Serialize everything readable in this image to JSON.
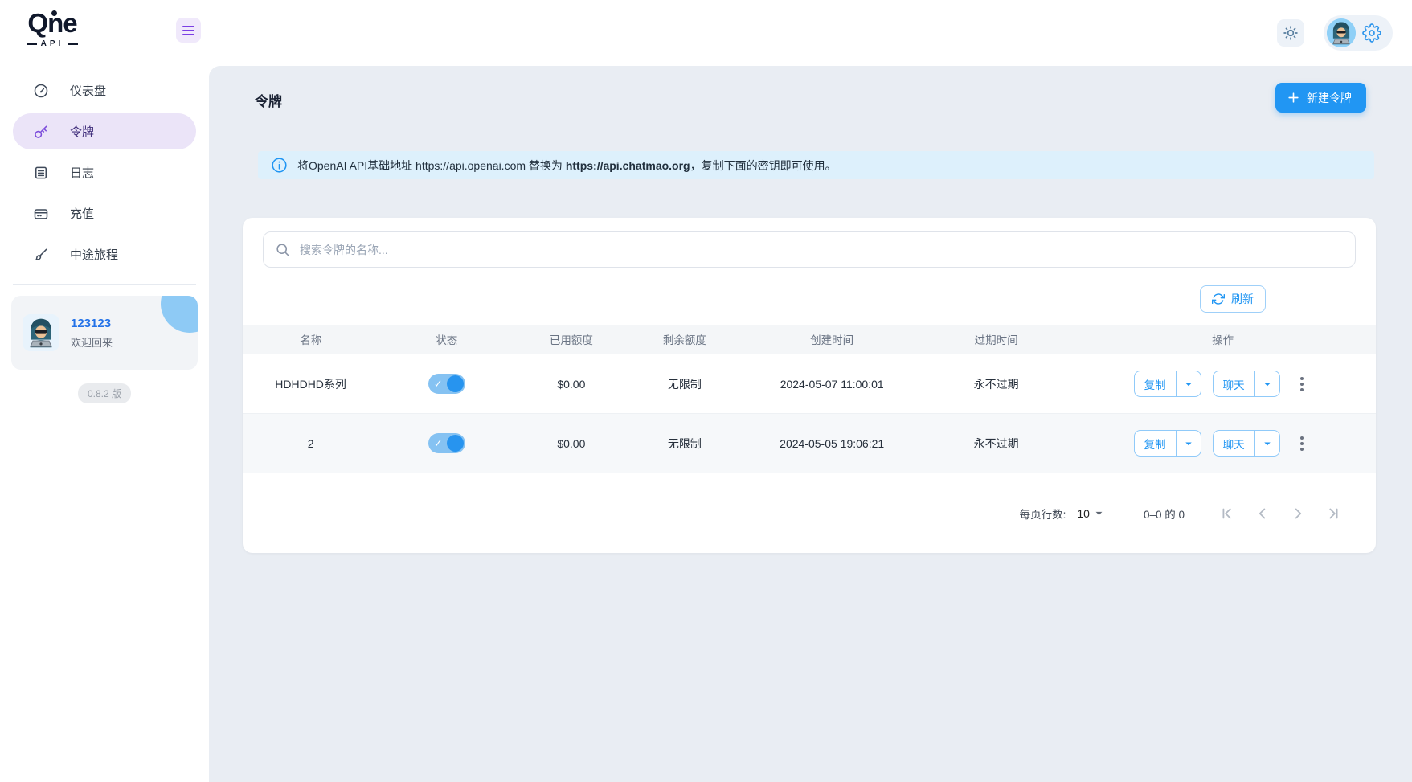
{
  "brand": {
    "name": "Qne",
    "sub": "API"
  },
  "sidebar": {
    "items": [
      {
        "label": "仪表盘"
      },
      {
        "label": "令牌"
      },
      {
        "label": "日志"
      },
      {
        "label": "充值"
      },
      {
        "label": "中途旅程"
      }
    ],
    "user": {
      "name": "123123",
      "greeting": "欢迎回来"
    },
    "version": "0.8.2 版"
  },
  "page": {
    "title": "令牌",
    "new_button": "新建令牌"
  },
  "notice": {
    "prefix": "将OpenAI API基础地址 https://api.openai.com 替换为 ",
    "highlight": "https://api.chatmao.org",
    "suffix": "，复制下面的密钥即可使用。"
  },
  "search": {
    "placeholder": "搜索令牌的名称..."
  },
  "toolbar": {
    "refresh": "刷新"
  },
  "icons": {
    "check": "✓"
  },
  "table": {
    "headers": [
      "名称",
      "状态",
      "已用额度",
      "剩余额度",
      "创建时间",
      "过期时间",
      "操作"
    ],
    "actions": {
      "copy": "复制",
      "chat": "聊天"
    },
    "rows": [
      {
        "name": "HDHDHD系列",
        "enabled": true,
        "used": "$0.00",
        "remaining": "无限制",
        "created": "2024-05-07 11:00:01",
        "expires": "永不过期"
      },
      {
        "name": "2",
        "enabled": true,
        "used": "$0.00",
        "remaining": "无限制",
        "created": "2024-05-05 19:06:21",
        "expires": "永不过期"
      }
    ]
  },
  "pagination": {
    "rows_per_page_label": "每页行数:",
    "page_size": "10",
    "range": "0–0 的 0"
  },
  "colors": {
    "primary": "#2196f3",
    "accent_purple": "#7b3fe4",
    "banner_bg": "#ddf0fc"
  }
}
